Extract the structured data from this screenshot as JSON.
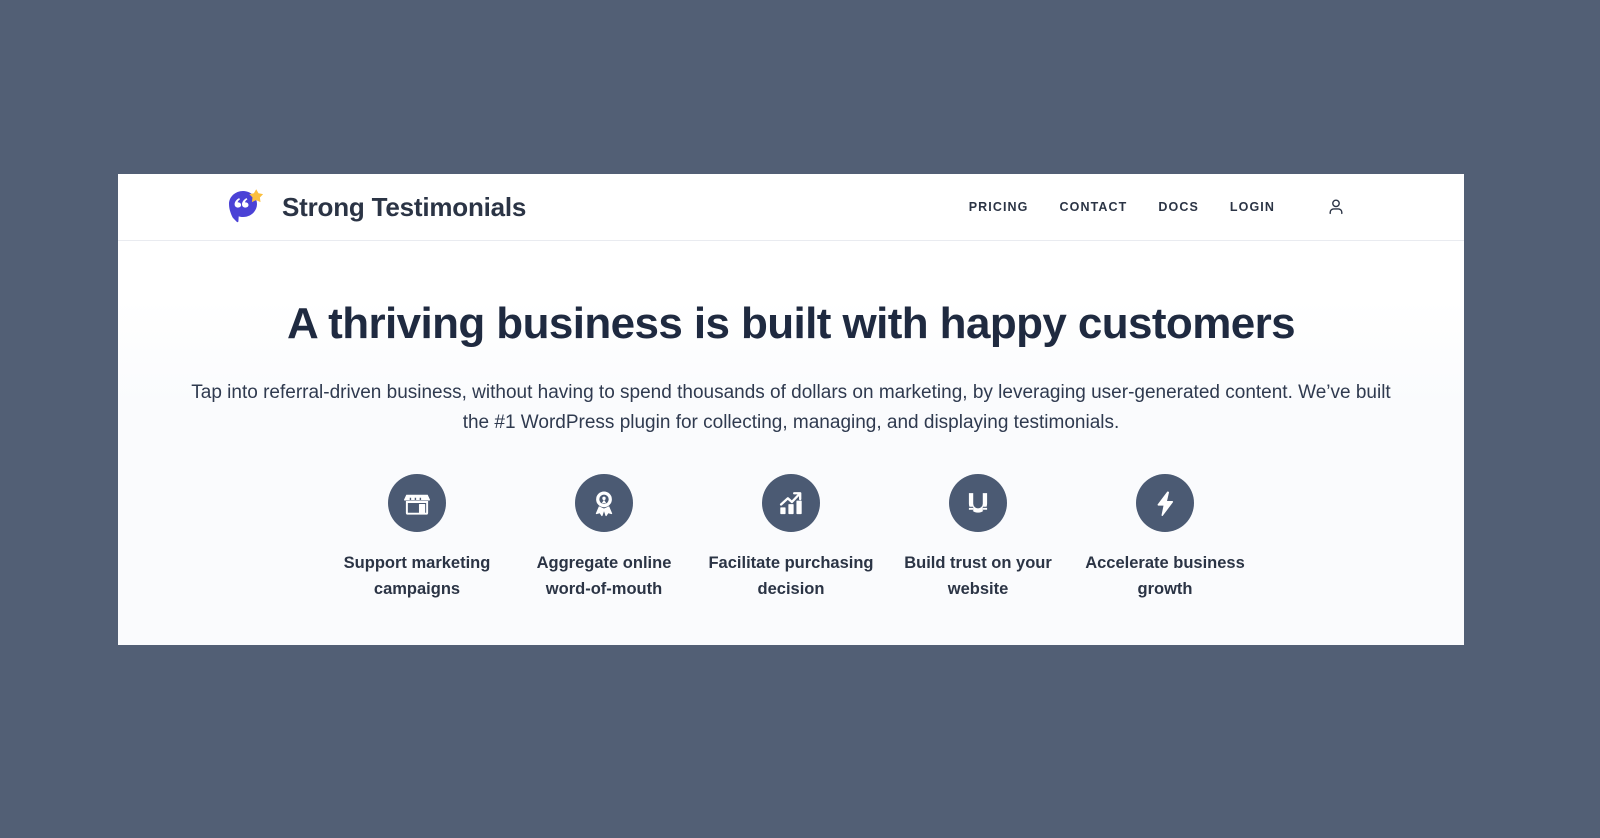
{
  "background_color": "#525f75",
  "brand": {
    "name": "Strong Testimonials",
    "logo_icon": "quote-bubble-star-icon",
    "logo_bubble_color": "#4b42d6",
    "logo_star_color": "#fbbf3e"
  },
  "nav": {
    "items": [
      {
        "label": "PRICING",
        "name": "nav-link-pricing"
      },
      {
        "label": "CONTACT",
        "name": "nav-link-contact"
      },
      {
        "label": "DOCS",
        "name": "nav-link-docs"
      },
      {
        "label": "LOGIN",
        "name": "nav-link-login"
      }
    ],
    "account_icon": "user-account-icon"
  },
  "hero": {
    "title": "A thriving business is built with happy customers",
    "subtitle": "Tap into referral-driven business, without having to spend thousands of dollars on marketing, by leveraging user-generated content. We’ve built the #1 WordPress plugin for collecting, managing, and displaying testimonials.",
    "accent_color": "#4b5a73",
    "heading_color": "#1f2a40"
  },
  "features": [
    {
      "label": "Support marketing campaigns",
      "icon": "storefront-icon"
    },
    {
      "label": "Aggregate online word-of-mouth",
      "icon": "award-ribbon-icon"
    },
    {
      "label": "Facilitate purchasing decision",
      "icon": "growth-chart-icon"
    },
    {
      "label": "Build trust on your website",
      "icon": "magnet-icon"
    },
    {
      "label": "Accelerate business growth",
      "icon": "lightning-bolt-icon"
    }
  ]
}
